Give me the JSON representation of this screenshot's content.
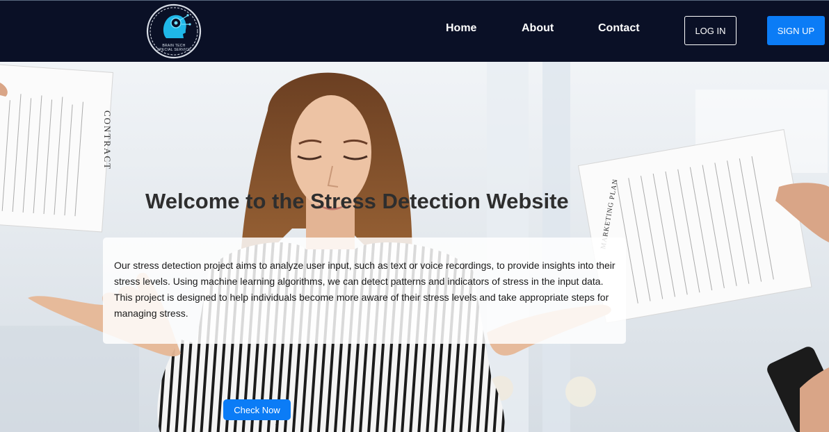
{
  "navbar": {
    "logo": {
      "icon": "brain-head-logo-icon",
      "text_line1": "BRAIN TECH",
      "text_line2": "SPECIAL SERVICE"
    },
    "links": [
      {
        "label": "Home"
      },
      {
        "label": "About"
      },
      {
        "label": "Contact"
      }
    ],
    "login_label": "LOG IN",
    "signup_label": "SIGN UP"
  },
  "hero": {
    "title": "Welcome to the Stress Detection Website",
    "description": "Our stress detection project aims to analyze user input, such as text or voice recordings, to provide insights into their stress levels. Using machine learning algorithms, we can detect patterns and indicators of stress in the input data. This project is designed to help individuals become more aware of their stress levels and take appropriate steps for managing stress.",
    "cta_label": "Check Now",
    "photo_paper_left_label": "CONTRACT",
    "photo_paper_right_label": "MARKETING PLAN"
  },
  "colors": {
    "navbar_bg": "#0a1026",
    "accent": "#0b7cf6",
    "title": "#2e2e2e",
    "text": "#1a1a1a"
  }
}
